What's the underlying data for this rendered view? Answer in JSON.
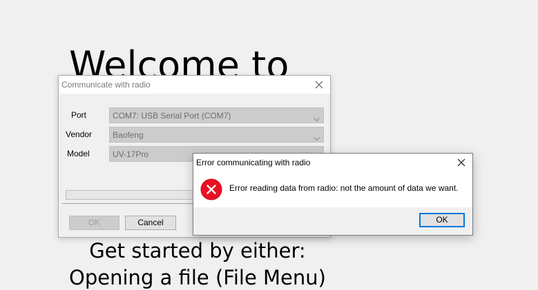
{
  "background": {
    "title": "Welcome to",
    "line1": "Get started by either:",
    "line2": "Opening a file (File Menu)"
  },
  "comm_dialog": {
    "title": "Communicate with radio",
    "port_label": "Port",
    "port_value": "COM7: USB Serial Port (COM7)",
    "vendor_label": "Vendor",
    "vendor_value": "Baofeng",
    "model_label": "Model",
    "model_value": "UV-17Pro",
    "progress": 0,
    "ok_label": "OK",
    "cancel_label": "Cancel"
  },
  "error_dialog": {
    "title": "Error communicating with radio",
    "message": "Error reading data from radio: not the amount of data we want.",
    "ok_label": "OK",
    "icon": "error-icon",
    "icon_color": "#e81123"
  }
}
